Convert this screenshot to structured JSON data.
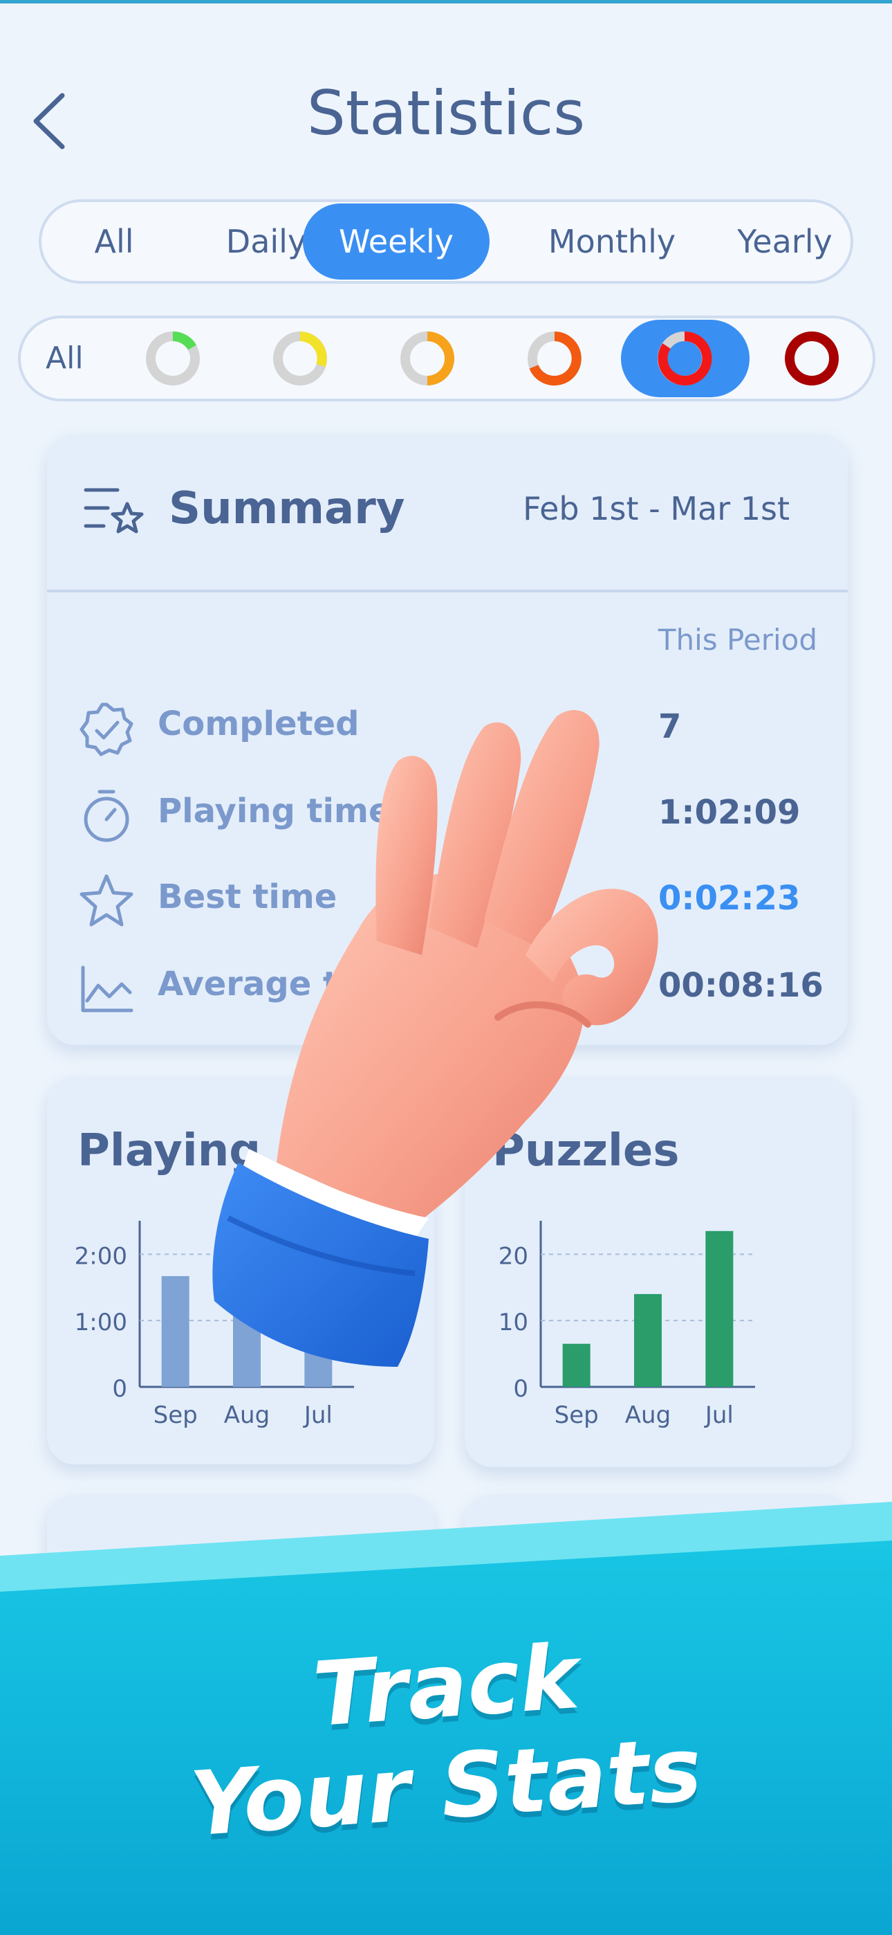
{
  "header": {
    "title": "Statistics"
  },
  "period_tabs": [
    {
      "label": "All"
    },
    {
      "label": "Daily"
    },
    {
      "label": "Weekly",
      "active": true
    },
    {
      "label": "Monthly"
    },
    {
      "label": "Yearly"
    }
  ],
  "difficulty_filter": {
    "all_label": "All",
    "rings": [
      {
        "color": "#55dd55",
        "active": false
      },
      {
        "color": "#f2e22a",
        "active": false
      },
      {
        "color": "#f7a21b",
        "active": false
      },
      {
        "color": "#f25a12",
        "active": false
      },
      {
        "color": "#f21818",
        "active": true
      },
      {
        "color": "#a80000",
        "active": false
      }
    ]
  },
  "summary": {
    "title": "Summary",
    "date_range": "Feb 1st - Mar 1st",
    "column_header": "This Period",
    "rows": [
      {
        "icon": "badge-check-icon",
        "label": "Completed",
        "value": "7"
      },
      {
        "icon": "stopwatch-icon",
        "label": "Playing time",
        "value": "1:02:09"
      },
      {
        "icon": "star-icon",
        "label": "Best time",
        "value": "0:02:23",
        "highlight": true
      },
      {
        "icon": "trend-chart-icon",
        "label": "Average tir",
        "value": "00:08:16"
      }
    ]
  },
  "charts": {
    "playing": {
      "title": "Playing"
    },
    "puzzles": {
      "title": "Puzzles"
    }
  },
  "chart_data": [
    {
      "type": "bar",
      "categories": [
        "Sep",
        "Aug",
        "Jul"
      ],
      "values": [
        1.67,
        1.2,
        0.9
      ],
      "ytick_labels": [
        "0",
        "1:00",
        "2:00"
      ],
      "ylim": [
        0,
        2.4
      ],
      "color": "#7fa3d4",
      "grid": true
    },
    {
      "type": "bar",
      "categories": [
        "Sep",
        "Aug",
        "Jul"
      ],
      "values": [
        6.5,
        14,
        23.5
      ],
      "ytick_labels": [
        "0",
        "10",
        "20"
      ],
      "ylim": [
        0,
        24
      ],
      "color": "#2a9d6b",
      "grid": true
    }
  ],
  "promo": {
    "line1": "Track",
    "line2": "Your Stats"
  }
}
